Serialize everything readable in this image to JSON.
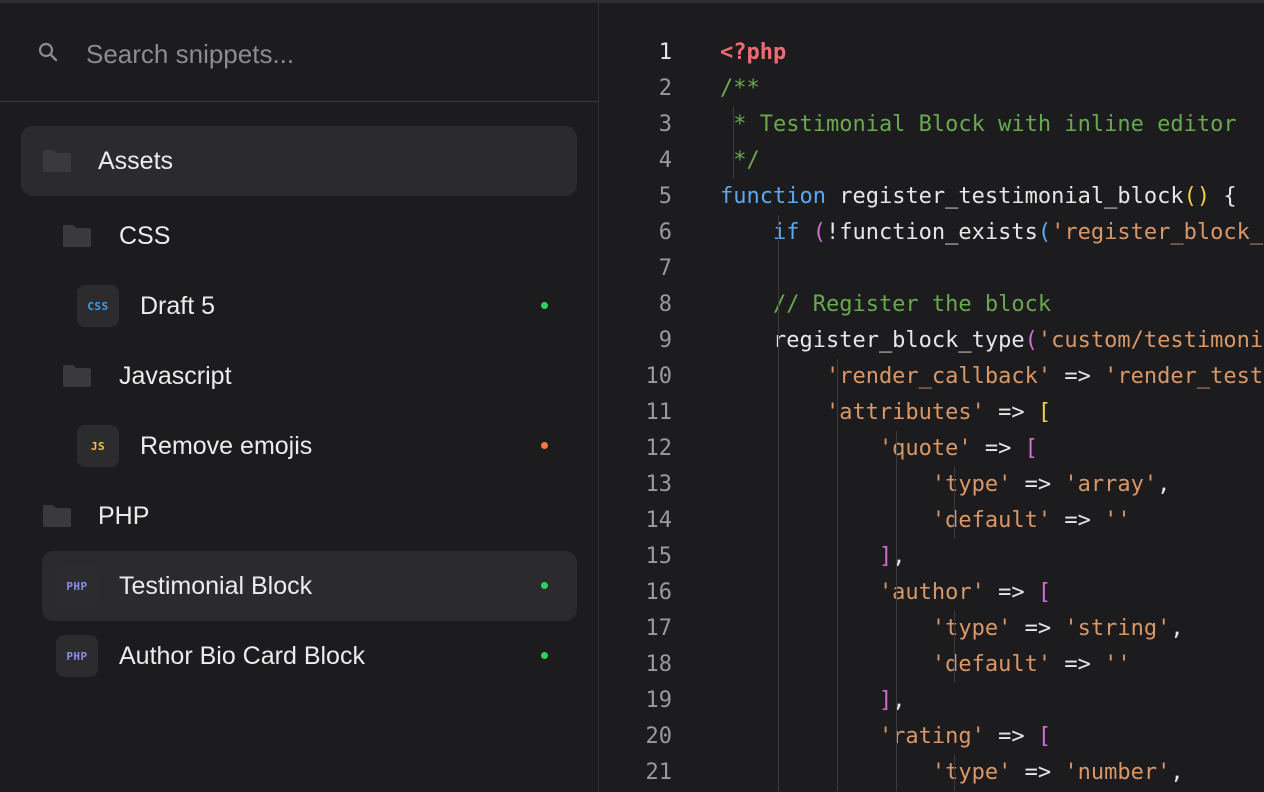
{
  "search": {
    "placeholder": "Search snippets..."
  },
  "tree": [
    {
      "kind": "folder",
      "label": "Assets",
      "selected": true
    },
    {
      "kind": "folder",
      "label": "CSS"
    },
    {
      "kind": "file",
      "label": "Draft 5",
      "lang": "CSS",
      "status_color": "#30d158"
    },
    {
      "kind": "folder",
      "label": "Javascript"
    },
    {
      "kind": "file",
      "label": "Remove emojis",
      "lang": "JS",
      "status_color": "#f5793b"
    },
    {
      "kind": "folder",
      "label": "PHP"
    },
    {
      "kind": "file",
      "label": "Testimonial Block",
      "lang": "PHP",
      "status_color": "#30d158",
      "selected": true
    },
    {
      "kind": "file",
      "label": "Author Bio Card Block",
      "lang": "PHP",
      "status_color": "#30d158"
    }
  ],
  "badge_colors": {
    "CSS": "#3aa3f0",
    "JS": "#f2c53d",
    "PHP": "#8a8cf0"
  },
  "editor": {
    "active_line": 1,
    "lines": [
      {
        "n": "1",
        "tokens": [
          [
            "<?php",
            "t-php"
          ]
        ]
      },
      {
        "n": "2",
        "tokens": [
          [
            "/**",
            "t-comment"
          ]
        ]
      },
      {
        "n": "3",
        "tokens": [
          [
            " * Testimonial Block with inline editor",
            "t-comment"
          ]
        ]
      },
      {
        "n": "4",
        "tokens": [
          [
            " */",
            "t-comment"
          ]
        ]
      },
      {
        "n": "5",
        "tokens": [
          [
            "function",
            "t-kw"
          ],
          [
            " register_testimonial_block",
            "t-fn"
          ],
          [
            "()",
            "t-paren"
          ],
          [
            " {",
            "t-op"
          ]
        ]
      },
      {
        "n": "6",
        "tokens": [
          [
            "    if ",
            "t-kw"
          ],
          [
            "(",
            "t-paren2"
          ],
          [
            "!function_exists",
            "t-fn"
          ],
          [
            "(",
            "t-kw"
          ],
          [
            "'register_block_type'",
            "t-str"
          ]
        ]
      },
      {
        "n": "7",
        "tokens": []
      },
      {
        "n": "8",
        "tokens": [
          [
            "    // Register the block",
            "t-comment"
          ]
        ]
      },
      {
        "n": "9",
        "tokens": [
          [
            "    register_block_type",
            "t-fn"
          ],
          [
            "(",
            "t-paren2"
          ],
          [
            "'custom/testimonial'",
            "t-str"
          ]
        ]
      },
      {
        "n": "10",
        "tokens": [
          [
            "        'render_callback'",
            "t-str"
          ],
          [
            " => ",
            "t-op"
          ],
          [
            "'render_testimonial'",
            "t-str"
          ]
        ]
      },
      {
        "n": "11",
        "tokens": [
          [
            "        'attributes'",
            "t-str"
          ],
          [
            " => ",
            "t-op"
          ],
          [
            "[",
            "t-paren"
          ]
        ]
      },
      {
        "n": "12",
        "tokens": [
          [
            "            'quote'",
            "t-str"
          ],
          [
            " => ",
            "t-op"
          ],
          [
            "[",
            "t-paren2"
          ]
        ]
      },
      {
        "n": "13",
        "tokens": [
          [
            "                'type'",
            "t-str"
          ],
          [
            " => ",
            "t-op"
          ],
          [
            "'array'",
            "t-str"
          ],
          [
            ",",
            "t-op"
          ]
        ]
      },
      {
        "n": "14",
        "tokens": [
          [
            "                'default'",
            "t-str"
          ],
          [
            " => ",
            "t-op"
          ],
          [
            "''",
            "t-str"
          ]
        ]
      },
      {
        "n": "15",
        "tokens": [
          [
            "            ]",
            "t-paren2"
          ],
          [
            ",",
            "t-op"
          ]
        ]
      },
      {
        "n": "16",
        "tokens": [
          [
            "            'author'",
            "t-str"
          ],
          [
            " => ",
            "t-op"
          ],
          [
            "[",
            "t-paren2"
          ]
        ]
      },
      {
        "n": "17",
        "tokens": [
          [
            "                'type'",
            "t-str"
          ],
          [
            " => ",
            "t-op"
          ],
          [
            "'string'",
            "t-str"
          ],
          [
            ",",
            "t-op"
          ]
        ]
      },
      {
        "n": "18",
        "tokens": [
          [
            "                'default'",
            "t-str"
          ],
          [
            " => ",
            "t-op"
          ],
          [
            "''",
            "t-str"
          ]
        ]
      },
      {
        "n": "19",
        "tokens": [
          [
            "            ]",
            "t-paren2"
          ],
          [
            ",",
            "t-op"
          ]
        ]
      },
      {
        "n": "20",
        "tokens": [
          [
            "            'rating'",
            "t-str"
          ],
          [
            " => ",
            "t-op"
          ],
          [
            "[",
            "t-paren2"
          ]
        ]
      },
      {
        "n": "21",
        "tokens": [
          [
            "                'type'",
            "t-str"
          ],
          [
            " => ",
            "t-op"
          ],
          [
            "'number'",
            "t-str"
          ],
          [
            ",",
            "t-op"
          ]
        ]
      }
    ]
  }
}
